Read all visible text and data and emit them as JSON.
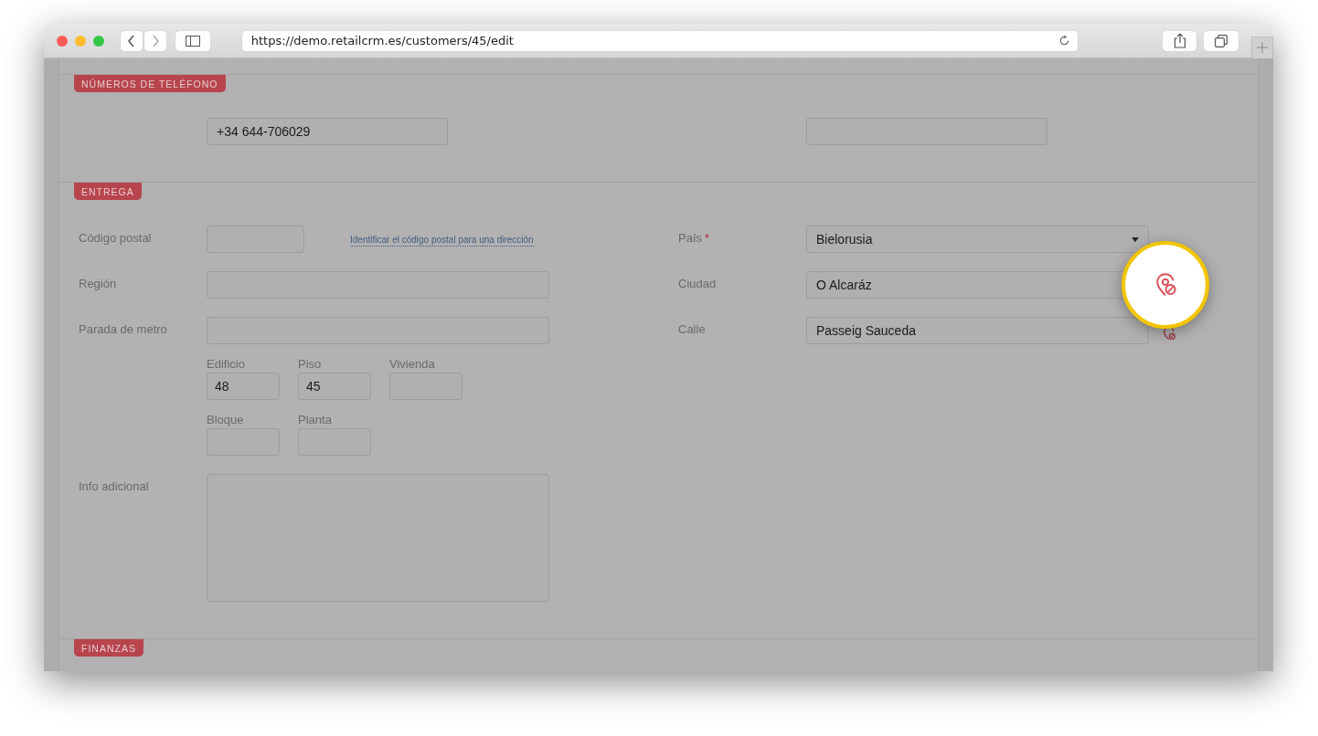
{
  "browser": {
    "url": "https://demo.retailcrm.es/customers/45/edit"
  },
  "phones": {
    "tag": "NÚMEROS DE TELÉFONO",
    "fields": [
      {
        "kind": "phone",
        "value": "+34 644-706029"
      },
      {
        "kind": "phone"
      }
    ]
  },
  "delivery": {
    "tag": "ENTREGA",
    "left": [
      {
        "label": "Código postal",
        "kind": "short",
        "link": "Identificar el código postal para una dirección"
      },
      {
        "label": "Región",
        "kind": "text"
      },
      {
        "label": "Parada de metro",
        "kind": "text"
      }
    ],
    "subfields": [
      [
        {
          "label": "Edificio",
          "value": "48"
        },
        {
          "label": "Piso",
          "value": "45"
        },
        {
          "label": "Vivienda"
        }
      ],
      [
        {
          "label": "Bloque"
        },
        {
          "label": "Planta"
        }
      ]
    ],
    "notes": {
      "label": "Info adicional"
    },
    "right": [
      {
        "label": "País",
        "required_mark": "*",
        "kind": "select",
        "value": "Bielorusia",
        "locate_icon": false
      },
      {
        "label": "Ciudad",
        "kind": "text",
        "value": "O Alcaráz",
        "locate_icon": false
      },
      {
        "label": "Calle",
        "kind": "text",
        "value": "Passeig Sauceda",
        "locate_icon": true
      }
    ]
  },
  "finance": {
    "tag": "FINANZAS"
  }
}
